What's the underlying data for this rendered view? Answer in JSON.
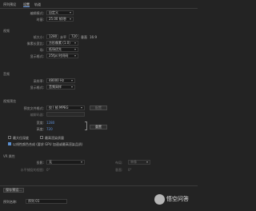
{
  "header": {
    "title": "序列预设",
    "tabs": [
      "设置",
      "轨道"
    ]
  },
  "edit": {
    "mode_label": "编辑模式:",
    "mode_value": "自定义",
    "timebase_label": "时基:",
    "timebase_value": "25.00 帧/秒"
  },
  "video": {
    "section": "视频",
    "frame_size_label": "帧大小:",
    "frame_w": "1280",
    "frame_h_label": "水平",
    "frame_h": "720",
    "frame_ratio_label": "垂直",
    "frame_ratio": "16:9",
    "pixel_label": "像素长宽比:",
    "pixel_value": "方形像素 (1.0)",
    "field_label": "场:",
    "field_value": "低场优先",
    "display_label": "显示格式:",
    "display_value": "25fps 时间码"
  },
  "audio": {
    "section": "音频",
    "rate_label": "采样率:",
    "rate_value": "48000 Hz",
    "display_label": "显示格式:",
    "display_value": "音频采样"
  },
  "preview": {
    "section": "视频预览",
    "format_label": "预览文件格式:",
    "format_value": "仅 I 帧 MPEG",
    "config_button": "配置",
    "codec_label": "编解码器:",
    "codec_value": "",
    "width_label": "宽度:",
    "width_value": "1280",
    "height_label": "高度:",
    "height_value": "720",
    "reset_button": "重置",
    "max_depth": "最大位深度",
    "max_quality": "最高渲染质量",
    "linear_color": "以线性颜色合成 (要求 GPU 加速或最高渲染品质)"
  },
  "vr": {
    "section": "VR 属性",
    "projection_label": "投影:",
    "projection_value": "无",
    "layout_label": "布局:",
    "layout_value": "单像",
    "h_label": "水平捕捉的视图:",
    "h_value": "0°",
    "v_label": "垂直:",
    "v_value": "0°"
  },
  "footer": {
    "save_button": "保存预设...",
    "name_label": "序列名称:",
    "name_value": "序列 01"
  },
  "watermark": {
    "text": "悟空问答"
  }
}
